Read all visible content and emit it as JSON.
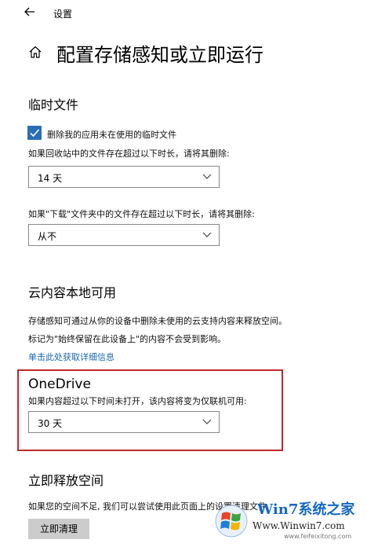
{
  "window": {
    "title": "设置"
  },
  "page": {
    "title": "配置存储感知或立即运行"
  },
  "temp_files": {
    "heading": "临时文件",
    "checkbox_label": "删除我的应用未在使用的临时文件",
    "checkbox_checked": true,
    "recycle_label": "如果回收站中的文件存在超过以下时长，请将其删除:",
    "recycle_value": "14 天",
    "downloads_label": "如果\"下载\"文件夹中的文件存在超过以下时长，请将其删除:",
    "downloads_value": "从不"
  },
  "cloud": {
    "heading": "云内容本地可用",
    "desc1": "存储感知可通过从你的设备中删除未使用的云支持内容来释放空间。",
    "desc2": "标记为\"始终保留在此设备上\"的内容不会受到影响。",
    "link": "单击此处获取详细信息"
  },
  "onedrive": {
    "heading": "OneDrive",
    "label": "如果内容超过以下时间未打开，该内容将变为仅联机可用:",
    "value": "30 天"
  },
  "free_space": {
    "heading": "立即释放空间",
    "desc": "如果您的空间不足, 我们可以尝试使用此页面上的设置清理文件",
    "button": "立即清理"
  },
  "watermark": {
    "site": "Win7系统之家",
    "url": "Www.Winwin7.com",
    "domain": "www.feifeixitong.com"
  },
  "colors": {
    "accent": "#2a6fb5",
    "highlight_border": "#c1272d",
    "link": "#1a67b0"
  },
  "icons": [
    "back-arrow-icon",
    "home-icon",
    "check-icon",
    "chevron-down-icon",
    "windows-logo-icon"
  ]
}
